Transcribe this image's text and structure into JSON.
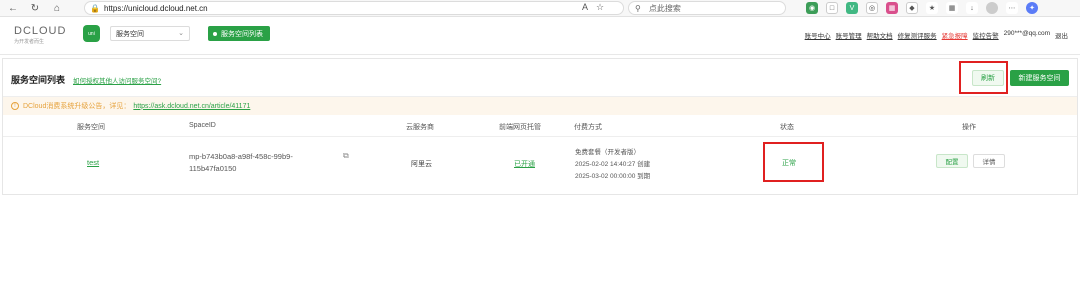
{
  "browser": {
    "url": "https://unicloud.dcloud.net.cn",
    "search_placeholder": "点此搜索"
  },
  "header": {
    "logo_text": "DCLOUD",
    "logo_slogan": "为开发者而生",
    "uni_icon_label": "uni",
    "space_select_value": "服务空间",
    "space_list_button": "服务空间列表",
    "links": [
      {
        "label": "账号中心",
        "style": "normal"
      },
      {
        "label": "账号管理",
        "style": "normal"
      },
      {
        "label": "帮助文档",
        "style": "normal"
      },
      {
        "label": "修复测评服务",
        "style": "normal"
      },
      {
        "label": "紧急报障",
        "style": "red"
      },
      {
        "label": "监控告警",
        "style": "normal"
      }
    ],
    "user_email": "290***@qq.com",
    "logout": "退出"
  },
  "panel": {
    "title": "服务空间列表",
    "help_link": "如何授权其他人访问服务空间?",
    "refresh_button": "刷新",
    "new_button": "新建服务空间",
    "notice_text": "DCloud消费系统升级公告，详见：",
    "notice_link": "https://ask.dcloud.net.cn/article/41171"
  },
  "table": {
    "headers": [
      "服务空间",
      "SpaceID",
      "云服务商",
      "前端网页托管",
      "付费方式",
      "状态",
      "操作"
    ],
    "rows": [
      {
        "name": "test",
        "space_id": "mp-b743b0a8-a98f-458c-99b9-115b47fa0150",
        "cloud": "阿里云",
        "hosting": "已开通",
        "plan": "免费套餐（开发者版）",
        "created": "2025-02-02 14:40:27 创建",
        "expires": "2025-03-02 00:00:00 到期",
        "status": "正常",
        "action_config": "配置",
        "action_detail": "详情"
      }
    ]
  },
  "colors": {
    "accent": "#2aa146",
    "highlight": "#e02020",
    "notice_bg": "#fdf6ec",
    "notice_text": "#e6a23c"
  }
}
